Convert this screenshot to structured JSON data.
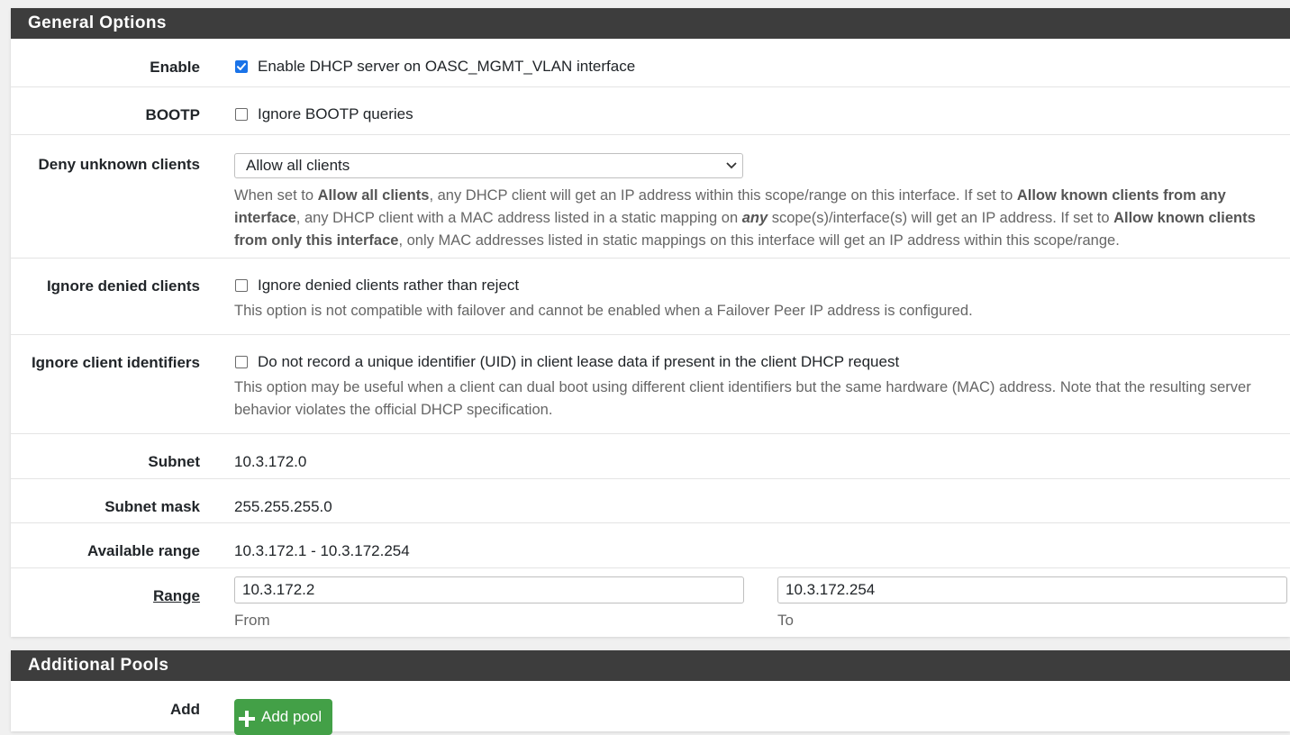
{
  "general_options": {
    "heading": "General Options",
    "enable": {
      "label": "Enable",
      "checkbox_label": "Enable DHCP server on OASC_MGMT_VLAN interface",
      "checked": true
    },
    "bootp": {
      "label": "BOOTP",
      "checkbox_label": "Ignore BOOTP queries",
      "checked": false
    },
    "deny_unknown": {
      "label": "Deny unknown clients",
      "selected": "Allow all clients",
      "help": {
        "t1": "When set to ",
        "b1": "Allow all clients",
        "t2": ", any DHCP client will get an IP address within this scope/range on this interface. If set to ",
        "b2": "Allow known clients from any interface",
        "t3": ", any DHCP client with a MAC address listed in a static mapping on ",
        "bi": "any",
        "t4": " scope(s)/interface(s) will get an IP address. If set to ",
        "b3": "Allow known clients from only this interface",
        "t5": ", only MAC addresses listed in static mappings on this interface will get an IP address within this scope/range."
      }
    },
    "ignore_denied": {
      "label": "Ignore denied clients",
      "checkbox_label": "Ignore denied clients rather than reject",
      "checked": false,
      "help": "This option is not compatible with failover and cannot be enabled when a Failover Peer IP address is configured."
    },
    "ignore_identifiers": {
      "label": "Ignore client identifiers",
      "checkbox_label": "Do not record a unique identifier (UID) in client lease data if present in the client DHCP request",
      "checked": false,
      "help": "This option may be useful when a client can dual boot using different client identifiers but the same hardware (MAC) address. Note that the resulting server behavior violates the official DHCP specification."
    },
    "subnet": {
      "label": "Subnet",
      "value": "10.3.172.0"
    },
    "subnet_mask": {
      "label": "Subnet mask",
      "value": "255.255.255.0"
    },
    "available_range": {
      "label": "Available range",
      "value": "10.3.172.1 - 10.3.172.254"
    },
    "range": {
      "label": "Range",
      "from_value": "10.3.172.2",
      "from_label": "From",
      "to_value": "10.3.172.254",
      "to_label": "To"
    }
  },
  "additional_pools": {
    "heading": "Additional Pools",
    "add_label": "Add",
    "add_button": "Add pool"
  },
  "colors": {
    "heading_bg": "#3d3d3d",
    "checkbox_checked": "#1a73e8",
    "add_button": "#43a047"
  },
  "icons": {
    "checked": "checkmark-icon",
    "select": "chevron-down-icon",
    "add": "plus-icon"
  }
}
